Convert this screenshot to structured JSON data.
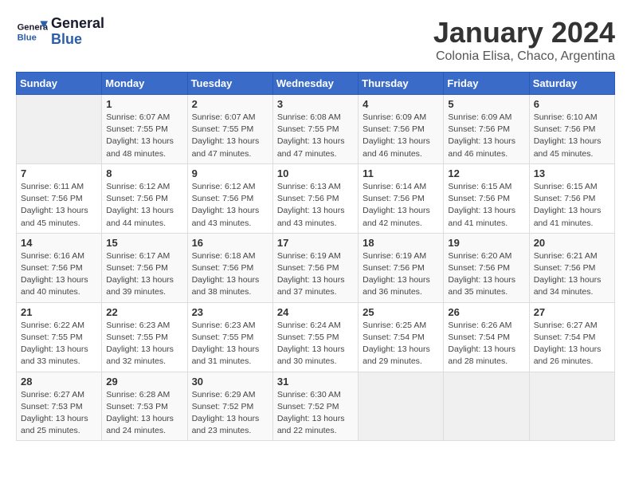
{
  "header": {
    "logo_general": "General",
    "logo_blue": "Blue",
    "title": "January 2024",
    "subtitle": "Colonia Elisa, Chaco, Argentina"
  },
  "calendar": {
    "days_of_week": [
      "Sunday",
      "Monday",
      "Tuesday",
      "Wednesday",
      "Thursday",
      "Friday",
      "Saturday"
    ],
    "weeks": [
      [
        {
          "day": "",
          "info": ""
        },
        {
          "day": "1",
          "info": "Sunrise: 6:07 AM\nSunset: 7:55 PM\nDaylight: 13 hours\nand 48 minutes."
        },
        {
          "day": "2",
          "info": "Sunrise: 6:07 AM\nSunset: 7:55 PM\nDaylight: 13 hours\nand 47 minutes."
        },
        {
          "day": "3",
          "info": "Sunrise: 6:08 AM\nSunset: 7:55 PM\nDaylight: 13 hours\nand 47 minutes."
        },
        {
          "day": "4",
          "info": "Sunrise: 6:09 AM\nSunset: 7:56 PM\nDaylight: 13 hours\nand 46 minutes."
        },
        {
          "day": "5",
          "info": "Sunrise: 6:09 AM\nSunset: 7:56 PM\nDaylight: 13 hours\nand 46 minutes."
        },
        {
          "day": "6",
          "info": "Sunrise: 6:10 AM\nSunset: 7:56 PM\nDaylight: 13 hours\nand 45 minutes."
        }
      ],
      [
        {
          "day": "7",
          "info": "Sunrise: 6:11 AM\nSunset: 7:56 PM\nDaylight: 13 hours\nand 45 minutes."
        },
        {
          "day": "8",
          "info": "Sunrise: 6:12 AM\nSunset: 7:56 PM\nDaylight: 13 hours\nand 44 minutes."
        },
        {
          "day": "9",
          "info": "Sunrise: 6:12 AM\nSunset: 7:56 PM\nDaylight: 13 hours\nand 43 minutes."
        },
        {
          "day": "10",
          "info": "Sunrise: 6:13 AM\nSunset: 7:56 PM\nDaylight: 13 hours\nand 43 minutes."
        },
        {
          "day": "11",
          "info": "Sunrise: 6:14 AM\nSunset: 7:56 PM\nDaylight: 13 hours\nand 42 minutes."
        },
        {
          "day": "12",
          "info": "Sunrise: 6:15 AM\nSunset: 7:56 PM\nDaylight: 13 hours\nand 41 minutes."
        },
        {
          "day": "13",
          "info": "Sunrise: 6:15 AM\nSunset: 7:56 PM\nDaylight: 13 hours\nand 41 minutes."
        }
      ],
      [
        {
          "day": "14",
          "info": "Sunrise: 6:16 AM\nSunset: 7:56 PM\nDaylight: 13 hours\nand 40 minutes."
        },
        {
          "day": "15",
          "info": "Sunrise: 6:17 AM\nSunset: 7:56 PM\nDaylight: 13 hours\nand 39 minutes."
        },
        {
          "day": "16",
          "info": "Sunrise: 6:18 AM\nSunset: 7:56 PM\nDaylight: 13 hours\nand 38 minutes."
        },
        {
          "day": "17",
          "info": "Sunrise: 6:19 AM\nSunset: 7:56 PM\nDaylight: 13 hours\nand 37 minutes."
        },
        {
          "day": "18",
          "info": "Sunrise: 6:19 AM\nSunset: 7:56 PM\nDaylight: 13 hours\nand 36 minutes."
        },
        {
          "day": "19",
          "info": "Sunrise: 6:20 AM\nSunset: 7:56 PM\nDaylight: 13 hours\nand 35 minutes."
        },
        {
          "day": "20",
          "info": "Sunrise: 6:21 AM\nSunset: 7:56 PM\nDaylight: 13 hours\nand 34 minutes."
        }
      ],
      [
        {
          "day": "21",
          "info": "Sunrise: 6:22 AM\nSunset: 7:55 PM\nDaylight: 13 hours\nand 33 minutes."
        },
        {
          "day": "22",
          "info": "Sunrise: 6:23 AM\nSunset: 7:55 PM\nDaylight: 13 hours\nand 32 minutes."
        },
        {
          "day": "23",
          "info": "Sunrise: 6:23 AM\nSunset: 7:55 PM\nDaylight: 13 hours\nand 31 minutes."
        },
        {
          "day": "24",
          "info": "Sunrise: 6:24 AM\nSunset: 7:55 PM\nDaylight: 13 hours\nand 30 minutes."
        },
        {
          "day": "25",
          "info": "Sunrise: 6:25 AM\nSunset: 7:54 PM\nDaylight: 13 hours\nand 29 minutes."
        },
        {
          "day": "26",
          "info": "Sunrise: 6:26 AM\nSunset: 7:54 PM\nDaylight: 13 hours\nand 28 minutes."
        },
        {
          "day": "27",
          "info": "Sunrise: 6:27 AM\nSunset: 7:54 PM\nDaylight: 13 hours\nand 26 minutes."
        }
      ],
      [
        {
          "day": "28",
          "info": "Sunrise: 6:27 AM\nSunset: 7:53 PM\nDaylight: 13 hours\nand 25 minutes."
        },
        {
          "day": "29",
          "info": "Sunrise: 6:28 AM\nSunset: 7:53 PM\nDaylight: 13 hours\nand 24 minutes."
        },
        {
          "day": "30",
          "info": "Sunrise: 6:29 AM\nSunset: 7:52 PM\nDaylight: 13 hours\nand 23 minutes."
        },
        {
          "day": "31",
          "info": "Sunrise: 6:30 AM\nSunset: 7:52 PM\nDaylight: 13 hours\nand 22 minutes."
        },
        {
          "day": "",
          "info": ""
        },
        {
          "day": "",
          "info": ""
        },
        {
          "day": "",
          "info": ""
        }
      ]
    ]
  }
}
